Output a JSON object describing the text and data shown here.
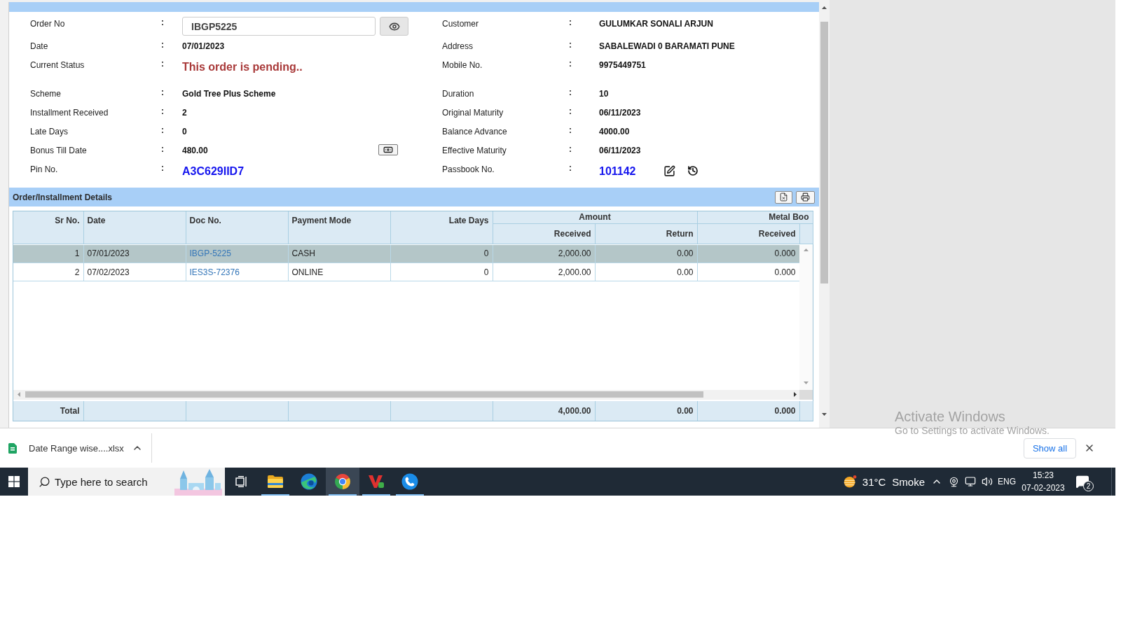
{
  "order_panel": {
    "field_groups": [
      [
        {
          "left": {
            "kind": "input",
            "label": "Order No",
            "separator": ":",
            "value": "IBGP5225"
          },
          "right": {
            "kind": "plain",
            "label": "Customer",
            "separator": ":",
            "value": "GULUMKAR SONALI ARJUN"
          }
        },
        {
          "left": {
            "kind": "plain",
            "label": "Date",
            "separator": ":",
            "value": "07/01/2023"
          },
          "right": {
            "kind": "plain",
            "label": "Address",
            "separator": ":",
            "value": "SABALEWADI 0 BARAMATI PUNE"
          }
        },
        {
          "left": {
            "kind": "status",
            "label": "Current Status",
            "separator": ":",
            "value": "This order is pending.."
          },
          "right": {
            "kind": "plain",
            "label": "Mobile No.",
            "separator": ":",
            "value": "9975449751"
          }
        }
      ],
      [
        {
          "left": {
            "kind": "plain",
            "label": "Scheme",
            "separator": ":",
            "value": "Gold Tree Plus Scheme"
          },
          "right": {
            "kind": "plain",
            "label": "Duration",
            "separator": ":",
            "value": "10"
          }
        },
        {
          "left": {
            "kind": "plain",
            "label": "Installment Received",
            "separator": ":",
            "value": "2"
          },
          "right": {
            "kind": "plain",
            "label": "Original Maturity",
            "separator": ":",
            "value": "06/11/2023"
          }
        },
        {
          "left": {
            "kind": "plain",
            "label": "Late Days",
            "separator": ":",
            "value": "0"
          },
          "right": {
            "kind": "plain",
            "label": "Balance Advance",
            "separator": ":",
            "value": "4000.00"
          }
        },
        {
          "left": {
            "kind": "withbutton",
            "label": "Bonus Till Date",
            "separator": ":",
            "value": "480.00"
          },
          "right": {
            "kind": "plain",
            "label": "Effective Maturity",
            "separator": ":",
            "value": "06/11/2023"
          }
        },
        {
          "left": {
            "kind": "code",
            "label": "Pin No.",
            "separator": ":",
            "value": "A3C629IID7"
          },
          "right": {
            "kind": "codeactions",
            "label": "Passbook No.",
            "separator": ":",
            "value": "101142"
          }
        }
      ]
    ]
  },
  "installments": {
    "title": "Order/Installment Details",
    "columns": [
      {
        "label": "Sr No.",
        "kind": "number"
      },
      {
        "label": "Date",
        "kind": "text"
      },
      {
        "label": "Doc No.",
        "kind": "link"
      },
      {
        "label": "Payment Mode",
        "kind": "text"
      },
      {
        "label": "Late Days",
        "kind": "number"
      }
    ],
    "column_groups": [
      {
        "label": "Amount",
        "columns": [
          {
            "label": "Received",
            "kind": "number"
          },
          {
            "label": "Return",
            "kind": "number"
          }
        ]
      },
      {
        "label": "Metal Boo",
        "columns": [
          {
            "label": "Received",
            "kind": "number"
          }
        ]
      }
    ],
    "rows": [
      {
        "selected": true,
        "cells": [
          "1",
          "07/01/2023",
          "IBGP-5225",
          "CASH",
          "0",
          "2,000.00",
          "0.00",
          "0.000"
        ]
      },
      {
        "selected": false,
        "cells": [
          "2",
          "07/02/2023",
          "IES3S-72376",
          "ONLINE",
          "0",
          "2,000.00",
          "0.00",
          "0.000"
        ]
      }
    ],
    "total": {
      "label": "Total",
      "values": [
        "4,000.00",
        "0.00",
        "0.000"
      ]
    }
  },
  "download_bar": {
    "file_name": "Date Range wise....xlsx",
    "show_all": "Show all"
  },
  "activation_notice": {
    "title": "Activate Windows",
    "message": "Go to Settings to activate Windows."
  },
  "taskbar": {
    "search": {
      "placeholder": "Type here to search"
    },
    "apps": [
      {
        "kind": "tasks",
        "running": false,
        "active": false
      },
      {
        "kind": "folder",
        "running": true,
        "active": false
      },
      {
        "kind": "swirl",
        "running": false,
        "active": false
      },
      {
        "kind": "orb",
        "running": true,
        "active": true
      },
      {
        "kind": "letter",
        "running": true,
        "active": false
      },
      {
        "kind": "phone",
        "running": true,
        "active": false
      }
    ],
    "weather": {
      "temperature": "31°C",
      "condition": "Smoke"
    },
    "language": "ENG",
    "time": "15:23",
    "date": "07-02-2023",
    "notification_count": "2"
  }
}
